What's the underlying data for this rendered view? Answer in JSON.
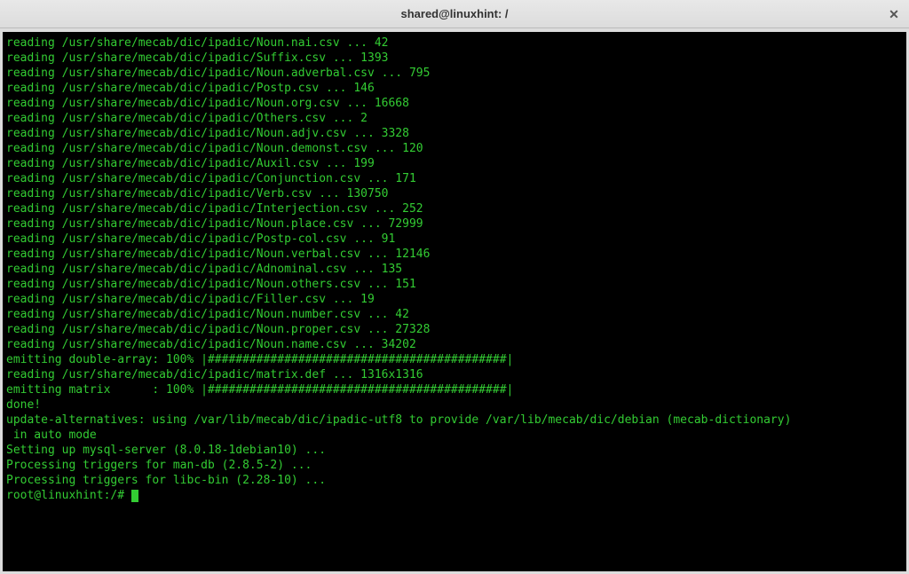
{
  "window": {
    "title": "shared@linuxhint: /",
    "close_symbol": "✕"
  },
  "terminal": {
    "lines": [
      "reading /usr/share/mecab/dic/ipadic/Noun.nai.csv ... 42",
      "reading /usr/share/mecab/dic/ipadic/Suffix.csv ... 1393",
      "reading /usr/share/mecab/dic/ipadic/Noun.adverbal.csv ... 795",
      "reading /usr/share/mecab/dic/ipadic/Postp.csv ... 146",
      "reading /usr/share/mecab/dic/ipadic/Noun.org.csv ... 16668",
      "reading /usr/share/mecab/dic/ipadic/Others.csv ... 2",
      "reading /usr/share/mecab/dic/ipadic/Noun.adjv.csv ... 3328",
      "reading /usr/share/mecab/dic/ipadic/Noun.demonst.csv ... 120",
      "reading /usr/share/mecab/dic/ipadic/Auxil.csv ... 199",
      "reading /usr/share/mecab/dic/ipadic/Conjunction.csv ... 171",
      "reading /usr/share/mecab/dic/ipadic/Verb.csv ... 130750",
      "reading /usr/share/mecab/dic/ipadic/Interjection.csv ... 252",
      "reading /usr/share/mecab/dic/ipadic/Noun.place.csv ... 72999",
      "reading /usr/share/mecab/dic/ipadic/Postp-col.csv ... 91",
      "reading /usr/share/mecab/dic/ipadic/Noun.verbal.csv ... 12146",
      "reading /usr/share/mecab/dic/ipadic/Adnominal.csv ... 135",
      "reading /usr/share/mecab/dic/ipadic/Noun.others.csv ... 151",
      "reading /usr/share/mecab/dic/ipadic/Filler.csv ... 19",
      "reading /usr/share/mecab/dic/ipadic/Noun.number.csv ... 42",
      "reading /usr/share/mecab/dic/ipadic/Noun.proper.csv ... 27328",
      "reading /usr/share/mecab/dic/ipadic/Noun.name.csv ... 34202",
      "emitting double-array: 100% |###########################################| ",
      "reading /usr/share/mecab/dic/ipadic/matrix.def ... 1316x1316",
      "emitting matrix      : 100% |###########################################| ",
      "",
      "done!",
      "update-alternatives: using /var/lib/mecab/dic/ipadic-utf8 to provide /var/lib/mecab/dic/debian (mecab-dictionary)",
      " in auto mode",
      "Setting up mysql-server (8.0.18-1debian10) ...",
      "Processing triggers for man-db (2.8.5-2) ...",
      "Processing triggers for libc-bin (2.28-10) ..."
    ],
    "prompt": "root@linuxhint:/#"
  }
}
